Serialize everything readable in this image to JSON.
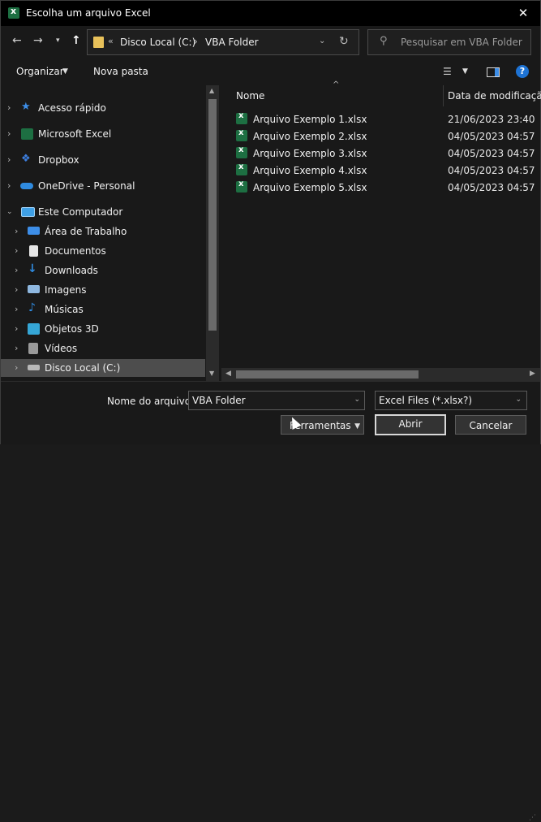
{
  "window": {
    "title": "Escolha um arquivo Excel",
    "close_glyph": "✕"
  },
  "address": {
    "overflow": "«",
    "crumbs": [
      "Disco Local (C:)",
      "VBA Folder"
    ],
    "separator": "›"
  },
  "search": {
    "placeholder": "Pesquisar em VBA Folder"
  },
  "toolbar": {
    "organize": "Organizar",
    "new_folder": "Nova pasta"
  },
  "sidebar": {
    "items": [
      {
        "label": "Acesso rápido",
        "icon": "star-icon",
        "color": "#3d8ee8"
      },
      {
        "label": "Microsoft Excel",
        "icon": "excel-icon",
        "color": "#1d6f42"
      },
      {
        "label": "Dropbox",
        "icon": "dropbox-icon",
        "color": "#3d7fe0"
      },
      {
        "label": "OneDrive - Personal",
        "icon": "cloud-icon",
        "color": "#2f8be0"
      },
      {
        "label": "Este Computador",
        "icon": "computer-icon",
        "color": "#3fa0e6"
      },
      {
        "label": "Área de Trabalho",
        "icon": "desktop-icon",
        "color": "#3d8ee8"
      },
      {
        "label": "Documentos",
        "icon": "document-icon",
        "color": "#e6e6e6"
      },
      {
        "label": "Downloads",
        "icon": "download-icon",
        "color": "#2f8be0"
      },
      {
        "label": "Imagens",
        "icon": "image-icon",
        "color": "#8fb8e0"
      },
      {
        "label": "Músicas",
        "icon": "music-icon",
        "color": "#2f8be0"
      },
      {
        "label": "Objetos 3D",
        "icon": "cube-icon",
        "color": "#35a6d6"
      },
      {
        "label": "Vídeos",
        "icon": "video-icon",
        "color": "#9a9a9a"
      },
      {
        "label": "Disco Local (C:)",
        "icon": "drive-icon",
        "color": "#b8b8b8"
      }
    ]
  },
  "files": {
    "columns": {
      "name": "Nome",
      "date": "Data de modificação"
    },
    "rows": [
      {
        "name": "Arquivo Exemplo 1.xlsx",
        "date": "21/06/2023 23:40"
      },
      {
        "name": "Arquivo Exemplo 2.xlsx",
        "date": "04/05/2023 04:57"
      },
      {
        "name": "Arquivo Exemplo 3.xlsx",
        "date": "04/05/2023 04:57"
      },
      {
        "name": "Arquivo Exemplo 4.xlsx",
        "date": "04/05/2023 04:57"
      },
      {
        "name": "Arquivo Exemplo 5.xlsx",
        "date": "04/05/2023 04:57"
      }
    ]
  },
  "footer": {
    "filename_label": "Nome do arquivo:",
    "filename_value": "VBA Folder",
    "filetype_value": "Excel Files (*.xlsx?)",
    "tools_label": "Ferramentas",
    "open_label": "Abrir",
    "cancel_label": "Cancelar"
  }
}
